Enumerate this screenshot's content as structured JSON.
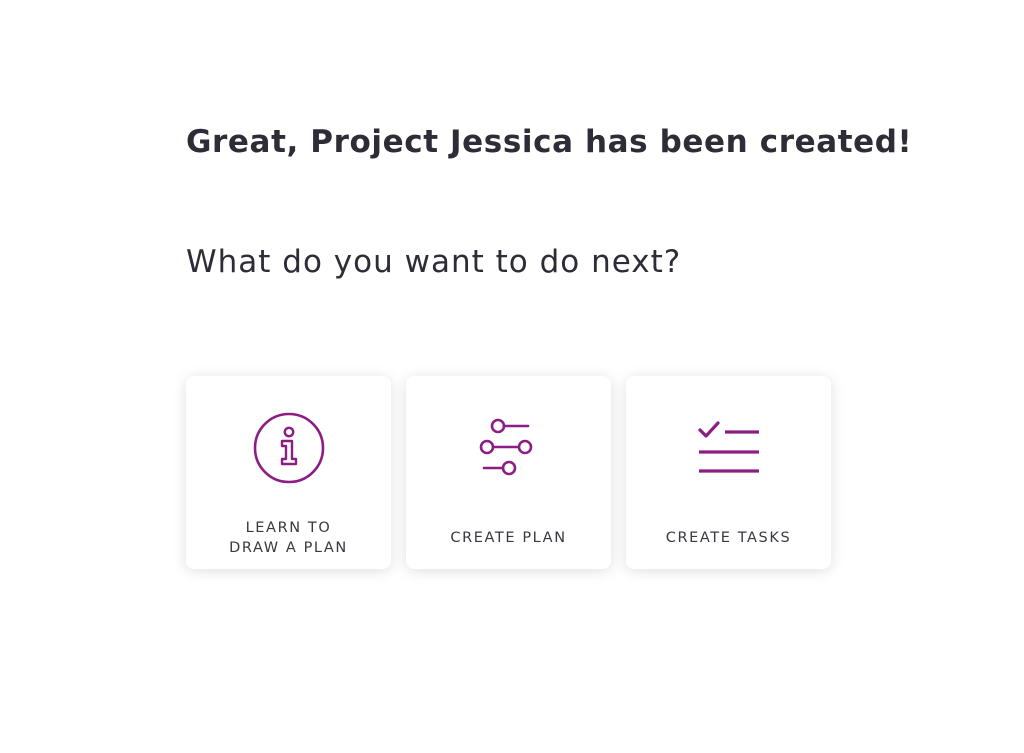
{
  "headline": "Great, Project Jessica has been created!",
  "question": "What do you want to do next?",
  "colors": {
    "accent": "#8b1d84",
    "text": "#2e2c36",
    "card_bg": "#ffffff"
  },
  "cards": [
    {
      "icon": "info-icon",
      "label_line1": "LEARN TO",
      "label_line2": "DRAW A PLAN"
    },
    {
      "icon": "sliders-icon",
      "label": "CREATE PLAN"
    },
    {
      "icon": "checklist-icon",
      "label": "CREATE TASKS"
    }
  ]
}
